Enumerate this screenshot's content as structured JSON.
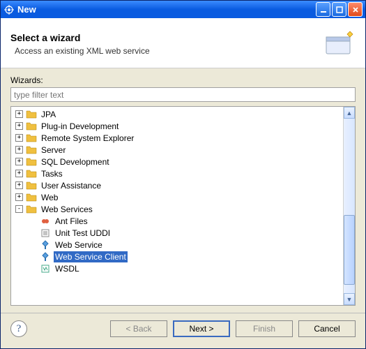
{
  "window": {
    "title": "New"
  },
  "header": {
    "title": "Select a wizard",
    "desc": "Access an existing XML web service"
  },
  "wizardsLabel": "Wizards",
  "filter": {
    "placeholder": "type filter text"
  },
  "tree": {
    "folders": [
      {
        "label": "JPA"
      },
      {
        "label": "Plug-in Development"
      },
      {
        "label": "Remote System Explorer"
      },
      {
        "label": "Server"
      },
      {
        "label": "SQL Development"
      },
      {
        "label": "Tasks"
      },
      {
        "label": "User Assistance"
      },
      {
        "label": "Web"
      }
    ],
    "expandedFolder": {
      "label": "Web Services"
    },
    "children": [
      {
        "label": "Ant Files",
        "icon": "ant"
      },
      {
        "label": "Unit Test UDDI",
        "icon": "uddi"
      },
      {
        "label": "Web Service",
        "icon": "ws"
      },
      {
        "label": "Web Service Client",
        "icon": "ws",
        "selected": true
      },
      {
        "label": "WSDL",
        "icon": "wsdl"
      }
    ]
  },
  "buttons": {
    "back": "< Back",
    "next": "Next >",
    "finish": "Finish",
    "cancel": "Cancel"
  }
}
